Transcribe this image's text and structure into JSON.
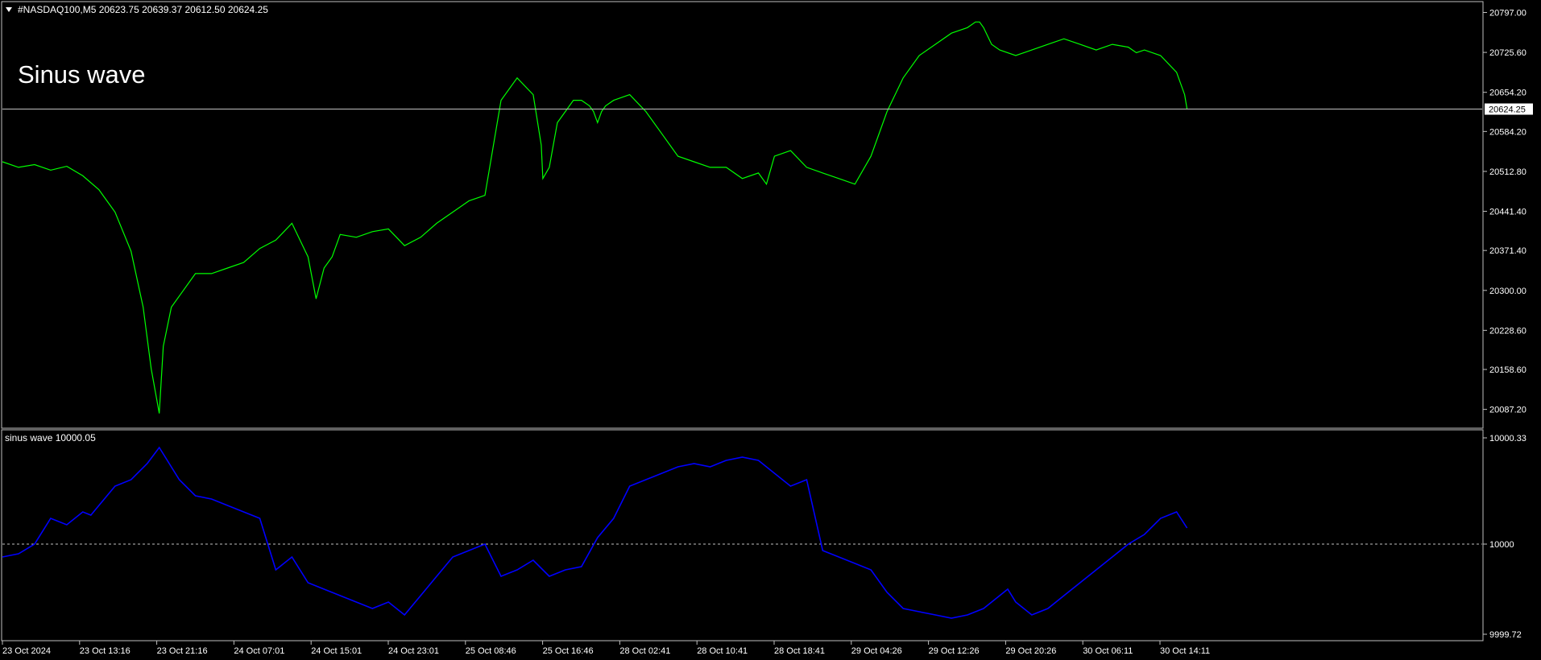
{
  "header": {
    "symbol_line": "#NASDAQ100,M5  20623.75 20639.37 20612.50 20624.25",
    "overlay_title": "Sinus wave"
  },
  "indicator": {
    "label": "sinus wave 10000.05"
  },
  "colors": {
    "background": "#000000",
    "price_line": "#00ff00",
    "indicator_line": "#0000ff",
    "frame": "#c0c0c0",
    "text": "#ffffff"
  },
  "chart_data": [
    {
      "type": "line",
      "title": "#NASDAQ100,M5",
      "series": [
        {
          "x": [
            0,
            20,
            40,
            60,
            80,
            100,
            120,
            140,
            160,
            175,
            185,
            195,
            200,
            210,
            225,
            240,
            260,
            280,
            300,
            320,
            340,
            360,
            380,
            390,
            400,
            410,
            420,
            440,
            460,
            480,
            500,
            520,
            540,
            560,
            580,
            600,
            620,
            640,
            660,
            670,
            672,
            680,
            690,
            700,
            710,
            720,
            730,
            735,
            740,
            745,
            750,
            760,
            780,
            800,
            820,
            840,
            860,
            880,
            900,
            920,
            940,
            950,
            960,
            980,
            1000,
            1020,
            1040,
            1060,
            1080,
            1100,
            1120,
            1140,
            1160,
            1180,
            1200,
            1210,
            1215,
            1220,
            1230,
            1240,
            1260,
            1280,
            1300,
            1320,
            1340,
            1360,
            1380,
            1400,
            1410,
            1420,
            1440,
            1460,
            1470,
            1473
          ],
          "values": [
            20530,
            20520,
            20525,
            20515,
            20522,
            20505,
            20480,
            20440,
            20370,
            20270,
            20160,
            20080,
            20200,
            20270,
            20300,
            20330,
            20330,
            20340,
            20350,
            20375,
            20390,
            20420,
            20360,
            20285,
            20340,
            20360,
            20400,
            20395,
            20405,
            20410,
            20380,
            20395,
            20420,
            20440,
            20460,
            20470,
            20640,
            20680,
            20650,
            20560,
            20500,
            20520,
            20600,
            20620,
            20640,
            20640,
            20630,
            20620,
            20600,
            20620,
            20630,
            20640,
            20650,
            20620,
            20580,
            20540,
            20530,
            20520,
            20520,
            20500,
            20510,
            20490,
            20540,
            20550,
            20520,
            20510,
            20500,
            20490,
            20540,
            20620,
            20680,
            20720,
            20740,
            20760,
            20770,
            20780,
            20780,
            20770,
            20740,
            20730,
            20720,
            20730,
            20740,
            20750,
            20740,
            20730,
            20740,
            20735,
            20725,
            20730,
            20720,
            20690,
            20650,
            20624.25
          ]
        }
      ],
      "ylim": [
        20055,
        20815
      ],
      "y_ticks": [
        "20797.00",
        "20725.60",
        "20654.20",
        "20584.20",
        "20512.80",
        "20441.40",
        "20371.40",
        "20300.00",
        "20228.60",
        "20158.60",
        "20087.20"
      ],
      "current_price": "20624.25"
    },
    {
      "type": "line",
      "title": "sinus wave 10000.05",
      "series": [
        {
          "x": [
            0,
            20,
            40,
            60,
            80,
            100,
            110,
            120,
            130,
            140,
            160,
            180,
            195,
            200,
            220,
            240,
            260,
            280,
            300,
            320,
            340,
            360,
            380,
            400,
            410,
            420,
            440,
            460,
            480,
            500,
            520,
            540,
            560,
            580,
            600,
            620,
            640,
            660,
            680,
            700,
            720,
            740,
            760,
            780,
            800,
            820,
            840,
            860,
            880,
            900,
            920,
            940,
            960,
            980,
            1000,
            1020,
            1040,
            1060,
            1080,
            1100,
            1120,
            1140,
            1160,
            1180,
            1200,
            1220,
            1240,
            1250,
            1260,
            1280,
            1300,
            1320,
            1340,
            1360,
            1380,
            1400,
            1420,
            1440,
            1460,
            1473
          ],
          "values": [
            9999.96,
            9999.97,
            10000.0,
            10000.08,
            10000.06,
            10000.1,
            10000.09,
            10000.12,
            10000.15,
            10000.18,
            10000.2,
            10000.25,
            10000.3,
            10000.28,
            10000.2,
            10000.15,
            10000.14,
            10000.12,
            10000.1,
            10000.08,
            9999.92,
            9999.96,
            9999.88,
            9999.86,
            9999.85,
            9999.84,
            9999.82,
            9999.8,
            9999.82,
            9999.78,
            9999.84,
            9999.9,
            9999.96,
            9999.98,
            10000.0,
            9999.9,
            9999.92,
            9999.95,
            9999.9,
            9999.92,
            9999.93,
            10000.02,
            10000.08,
            10000.18,
            10000.2,
            10000.22,
            10000.24,
            10000.25,
            10000.24,
            10000.26,
            10000.27,
            10000.26,
            10000.22,
            10000.18,
            10000.2,
            9999.98,
            9999.96,
            9999.94,
            9999.92,
            9999.85,
            9999.8,
            9999.79,
            9999.78,
            9999.77,
            9999.78,
            9999.8,
            9999.84,
            9999.86,
            9999.82,
            9999.78,
            9999.8,
            9999.84,
            9999.88,
            9999.92,
            9999.96,
            10000.0,
            10000.03,
            10000.08,
            10000.1,
            10000.05
          ]
        }
      ],
      "ylim": [
        9999.72,
        10000.33
      ],
      "y_ticks": [
        "10000.33",
        "10000",
        "9999.72"
      ],
      "reference_level": 10000
    }
  ],
  "x_axis": {
    "labels": [
      "23 Oct 2024",
      "23 Oct 13:16",
      "23 Oct 21:16",
      "24 Oct 07:01",
      "24 Oct 15:01",
      "24 Oct 23:01",
      "25 Oct 08:46",
      "25 Oct 16:46",
      "28 Oct 02:41",
      "28 Oct 10:41",
      "28 Oct 18:41",
      "29 Oct 04:26",
      "29 Oct 12:26",
      "29 Oct 20:26",
      "30 Oct 06:11",
      "30 Oct 14:11"
    ]
  }
}
